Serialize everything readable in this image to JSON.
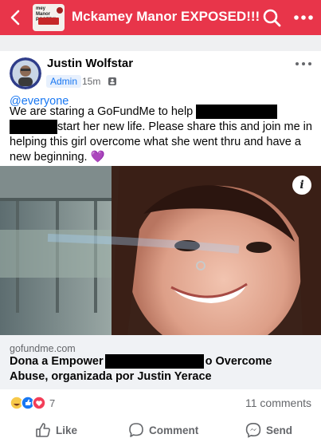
{
  "header": {
    "group_name": "Mckamey Manor EXPOSED!!!",
    "group_thumb_text": "mey Manor POSED!!",
    "icons": {
      "back": "chevron-left-icon",
      "search": "search-icon",
      "more": "more-horizontal-icon"
    },
    "background_color": "#e8354a"
  },
  "post": {
    "author": "Justin Wolfstar",
    "badge": "Admin",
    "time": "15m",
    "audience_icon": "group-audience-icon",
    "mention": "@everyone",
    "body_part1": "We are staring a GoFundMe to help",
    "body_part2": "start her new life. Please share this and join me in helping this girl overcome what she went thru and have a new beginning.",
    "emoji": "💜"
  },
  "link": {
    "domain": "gofundme.com",
    "title_part1": "Dona a Empower",
    "title_part2": "o Overcome Abuse, organizada por Justin Yerace"
  },
  "engagement": {
    "reaction_icons": [
      "haha-icon",
      "like-icon",
      "love-icon"
    ],
    "reaction_count": "7",
    "comments": "11 comments"
  },
  "actions": {
    "like": "Like",
    "comment": "Comment",
    "send": "Send"
  },
  "colors": {
    "accent": "#1877f2",
    "header": "#e8354a",
    "muted": "#65676b"
  }
}
